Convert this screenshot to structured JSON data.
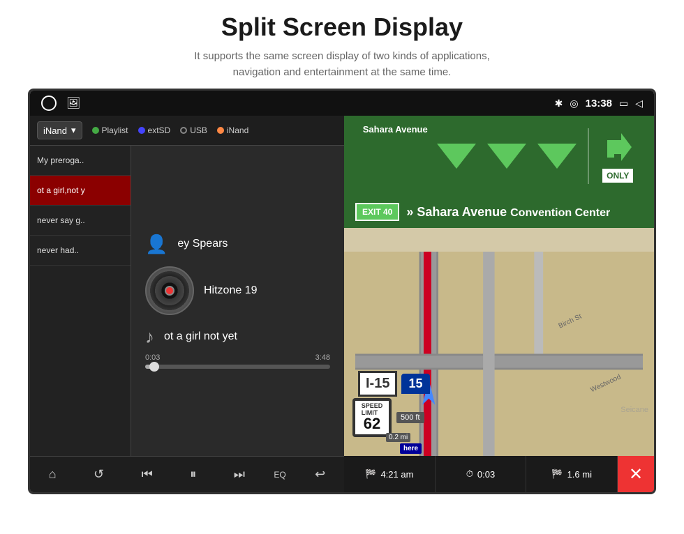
{
  "header": {
    "title": "Split Screen Display",
    "subtitle": "It supports the same screen display of two kinds of applications,\nnavigation and entertainment at the same time."
  },
  "status_bar": {
    "time": "13:38",
    "icons": [
      "bluetooth",
      "location",
      "screen",
      "back"
    ]
  },
  "music": {
    "source_dropdown": "iNand",
    "sources": [
      "Playlist",
      "extSD",
      "USB",
      "iNand"
    ],
    "playlist": [
      {
        "label": "My preroga..",
        "active": false
      },
      {
        "label": "ot a girl,not y",
        "active": true
      },
      {
        "label": "never say g..",
        "active": false
      },
      {
        "label": "never had..",
        "active": false
      }
    ],
    "artist": "ey Spears",
    "album": "Hitzone 19",
    "song": "ot a girl not yet",
    "time_current": "0:03",
    "time_total": "3:48",
    "controls": [
      "home",
      "repeat",
      "prev",
      "pause",
      "next",
      "eq",
      "back"
    ]
  },
  "navigation": {
    "highway_sign": "I-15",
    "exit_number": "EXIT 40",
    "exit_destination": "» Sahara Avenue",
    "exit_subtitle": "Convention Center",
    "speed_limit": "62",
    "distance_ft": "500 ft",
    "distance_mi": "0.2 mi",
    "road_labels": [
      "Birch St",
      "Westwood"
    ],
    "eta_time": "4:21 am",
    "eta_duration": "0:03",
    "eta_distance": "1.6 mi",
    "interstate_num": "I-15",
    "interstate_badge": "15",
    "only_label": "ONLY",
    "sahara_avenue": "Sahara Avenue"
  },
  "watermark": "Seicane"
}
